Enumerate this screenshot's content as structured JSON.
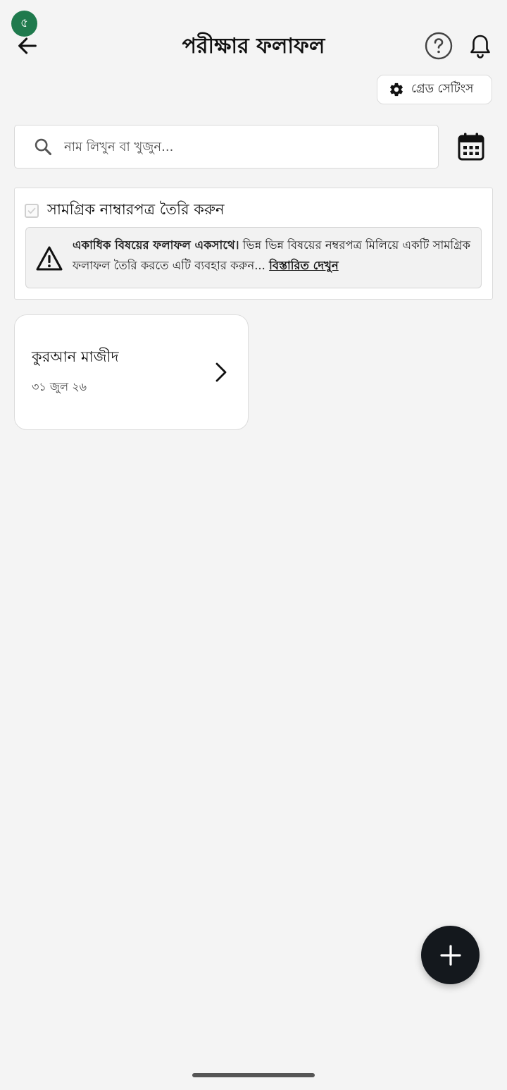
{
  "status": {
    "indicator_text": "৫"
  },
  "header": {
    "title": "পরীক্ষার ফলাফল"
  },
  "grade_settings": {
    "label": "গ্রেড সেটিংস"
  },
  "search": {
    "placeholder": "নাম লিখুন বা খুজুন..."
  },
  "combined": {
    "checkbox_label": "সামগ্রিক নাম্বারপত্র তৈরি করুন",
    "checked": false,
    "info_bold": "একাধিক বিষয়ের ফলাফল একসাথে।",
    "info_text": " ভিন্ন ভিন্ন বিষয়ের নম্বরপত্র মিলিয়ে একটি সামগ্রিক ফলাফল তৈরি করতে এটি ব্যবহার করুন... ",
    "info_link": "বিস্তারিত দেখুন"
  },
  "subjects": [
    {
      "name": "কুরআন মাজীদ",
      "date": "৩১ জুল ২৬"
    }
  ],
  "colors": {
    "background": "#f4f4f4",
    "status_dot": "#1f7a4d",
    "fab": "#14181d"
  },
  "icons": {
    "back": "arrow-left-icon",
    "help": "question-circle-icon",
    "notifications": "bell-icon",
    "grade_settings": "gear-icon",
    "search": "search-icon",
    "calendar": "calendar-icon",
    "warning": "warning-triangle-icon",
    "chevron": "chevron-right-icon",
    "fab": "plus-icon"
  }
}
